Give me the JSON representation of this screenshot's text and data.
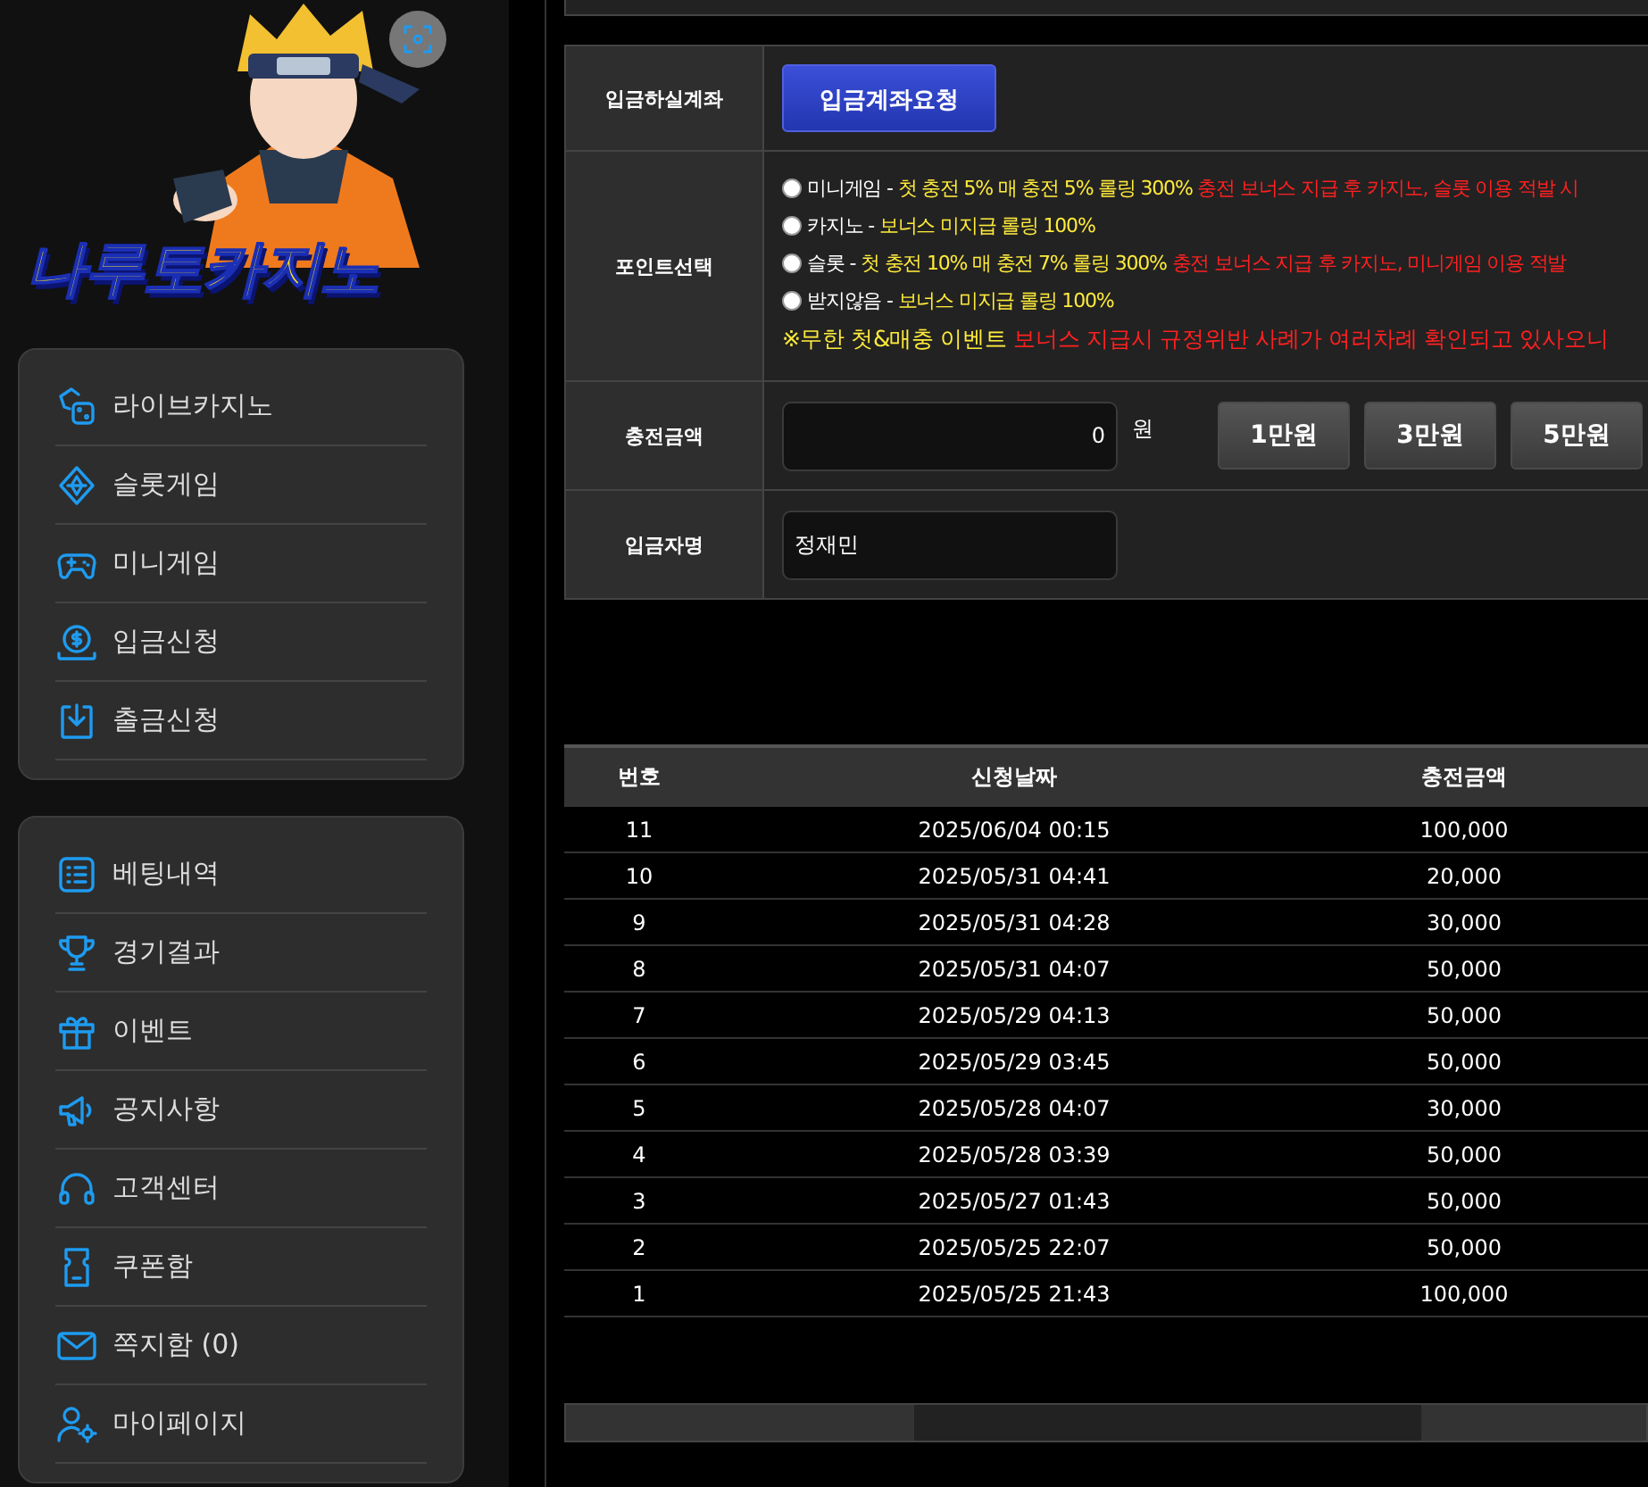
{
  "logo": {
    "text": "나루토카지노"
  },
  "menu_primary": [
    {
      "label": "라이브카지노"
    },
    {
      "label": "슬롯게임"
    },
    {
      "label": "미니게임"
    },
    {
      "label": "입금신청"
    },
    {
      "label": "출금신청"
    }
  ],
  "menu_secondary": [
    {
      "label": "베팅내역"
    },
    {
      "label": "경기결과"
    },
    {
      "label": "이벤트"
    },
    {
      "label": "공지사항"
    },
    {
      "label": "고객센터"
    },
    {
      "label": "쿠폰함"
    },
    {
      "label": "쪽지함 (0)"
    },
    {
      "label": "마이페이지"
    }
  ],
  "form": {
    "account_label": "입금하실계좌",
    "account_button": "입금계좌요청",
    "point_label": "포인트선택",
    "point_options": [
      {
        "name": "미니게임",
        "sep": "-",
        "bonus": "첫 충전 5% 매 충전 5% 롤링 300%",
        "warning": "충전 보너스 지급 후 카지노, 슬롯 이용 적발 시",
        "selected": false
      },
      {
        "name": "카지노",
        "sep": "-",
        "bonus": "보너스 미지급 롤링 100%",
        "selected": false
      },
      {
        "name": "슬롯",
        "sep": "-",
        "bonus": "첫 충전 10% 매 충전 7% 롤링 300%",
        "warning": "충전 보너스 지급 후 카지노, 미니게임 이용 적발",
        "selected": false
      },
      {
        "name": "받지않음",
        "sep": "-",
        "bonus": "보너스 미지급 롤링 100%",
        "selected": false
      }
    ],
    "event_title": "※무한 첫&매충 이벤트",
    "event_text": "보너스 지급시 규정위반 사례가 여러차례 확인되고 있사오니",
    "amount_label": "충전금액",
    "amount_value": "0",
    "amount_unit": "원",
    "amount_buttons": [
      "1만원",
      "3만원",
      "5만원"
    ],
    "name_label": "입금자명",
    "name_value": "정재민"
  },
  "history": {
    "columns": [
      "번호",
      "신청날짜",
      "충전금액"
    ],
    "rows": [
      [
        "11",
        "2025/06/04 00:15",
        "100,000"
      ],
      [
        "10",
        "2025/05/31 04:41",
        "20,000"
      ],
      [
        "9",
        "2025/05/31 04:28",
        "30,000"
      ],
      [
        "8",
        "2025/05/31 04:07",
        "50,000"
      ],
      [
        "7",
        "2025/05/29 04:13",
        "50,000"
      ],
      [
        "6",
        "2025/05/29 03:45",
        "50,000"
      ],
      [
        "5",
        "2025/05/28 04:07",
        "30,000"
      ],
      [
        "4",
        "2025/05/28 03:39",
        "50,000"
      ],
      [
        "3",
        "2025/05/27 01:43",
        "50,000"
      ],
      [
        "2",
        "2025/05/25 22:07",
        "50,000"
      ],
      [
        "1",
        "2025/05/25 21:43",
        "100,000"
      ]
    ]
  }
}
